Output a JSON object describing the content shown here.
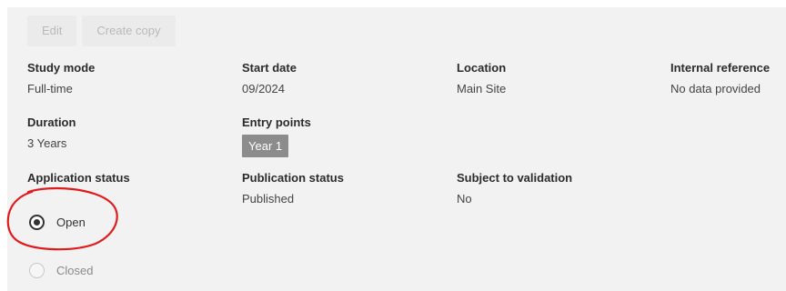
{
  "toolbar": {
    "edit_label": "Edit",
    "copy_label": "Create copy"
  },
  "fields": {
    "study_mode": {
      "label": "Study mode",
      "value": "Full-time"
    },
    "start_date": {
      "label": "Start date",
      "value": "09/2024"
    },
    "location": {
      "label": "Location",
      "value": "Main Site"
    },
    "internal_reference": {
      "label": "Internal reference",
      "value": "No data provided"
    },
    "duration": {
      "label": "Duration",
      "value": "3 Years"
    },
    "entry_points": {
      "label": "Entry points",
      "badge": "Year 1"
    },
    "application_status": {
      "label": "Application status",
      "options": [
        {
          "label": "Open",
          "selected": true
        },
        {
          "label": "Closed",
          "selected": false
        }
      ]
    },
    "publication_status": {
      "label": "Publication status",
      "value": "Published"
    },
    "subject_to_validation": {
      "label": "Subject to validation",
      "value": "No"
    }
  },
  "annotation": {
    "color": "#e01b1b"
  }
}
